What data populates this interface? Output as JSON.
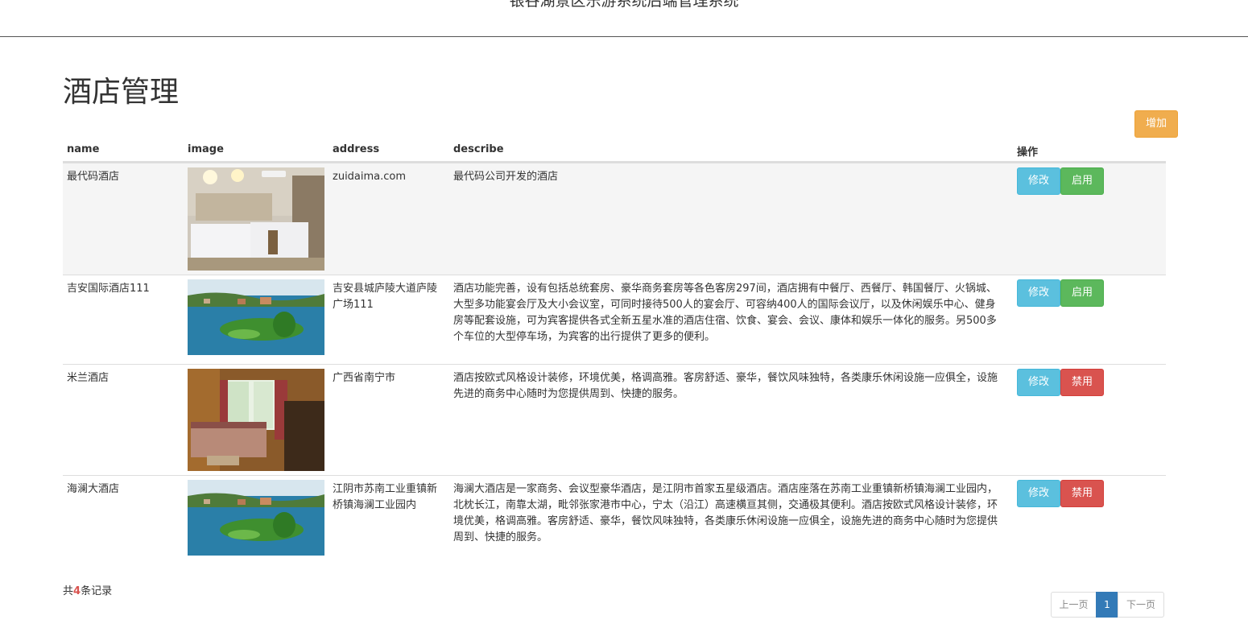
{
  "header": {
    "title": "银谷湖景区乐游系统后端管理系统"
  },
  "page": {
    "title": "酒店管理",
    "add_label": "增加"
  },
  "table": {
    "columns": [
      "name",
      "image",
      "address",
      "describe",
      "操作"
    ],
    "rows": [
      {
        "name": "最代码酒店",
        "image": "hotel-room-twin-beds",
        "address": "zuidaima.com",
        "describe": "最代码公司开发的酒店",
        "edit_label": "修改",
        "toggle_label": "启用",
        "toggle_color": "#5cb85c"
      },
      {
        "name": "吉安国际酒店111",
        "image": "lake-island-aerial",
        "address": "吉安县城庐陵大道庐陵广场111",
        "describe": "酒店功能完善，设有包括总统套房、豪华商务套房等各色客房297间，酒店拥有中餐厅、西餐厅、韩国餐厅、火锅城、大型多功能宴会厅及大小会议室，可同时接待500人的宴会厅、可容纳400人的国际会议厅，以及休闲娱乐中心、健身房等配套设施，可为宾客提供各式全新五星水准的酒店住宿、饮食、宴会、会议、康体和娱乐一体化的服务。另500多个车位的大型停车场，为宾客的出行提供了更多的便利。",
        "edit_label": "修改",
        "toggle_label": "启用",
        "toggle_color": "#5cb85c"
      },
      {
        "name": "米兰酒店",
        "image": "hotel-bedroom-window",
        "address": "广西省南宁市",
        "describe": "酒店按欧式风格设计装修，环境优美，格调高雅。客房舒适、豪华，餐饮风味独特，各类康乐休闲设施一应俱全，设施先进的商务中心随时为您提供周到、快捷的服务。",
        "edit_label": "修改",
        "toggle_label": "禁用",
        "toggle_color": "#d9534f"
      },
      {
        "name": "海澜大酒店",
        "image": "lake-island-aerial",
        "address": "江阴市苏南工业重镇新桥镇海澜工业园内",
        "describe": "海澜大酒店是一家商务、会议型豪华酒店，是江阴市首家五星级酒店。酒店座落在苏南工业重镇新桥镇海澜工业园内，北枕长江，南靠太湖，毗邻张家港市中心，宁太（沿江）高速横亘其侧，交通极其便利。酒店按欧式风格设计装修，环境优美，格调高雅。客房舒适、豪华，餐饮风味独特，各类康乐休闲设施一应俱全，设施先进的商务中心随时为您提供周到、快捷的服务。",
        "edit_label": "修改",
        "toggle_label": "禁用",
        "toggle_color": "#d9534f"
      }
    ]
  },
  "footer": {
    "count_prefix": "共",
    "count": "4",
    "count_suffix": "条记录"
  },
  "pagination": {
    "prev": "上一页",
    "current": "1",
    "next": "下一页"
  },
  "colors": {
    "add": "#f0ad4e",
    "edit": "#5bc0de",
    "enable": "#5cb85c",
    "disable": "#d9534f",
    "active_page": "#337ab7"
  }
}
